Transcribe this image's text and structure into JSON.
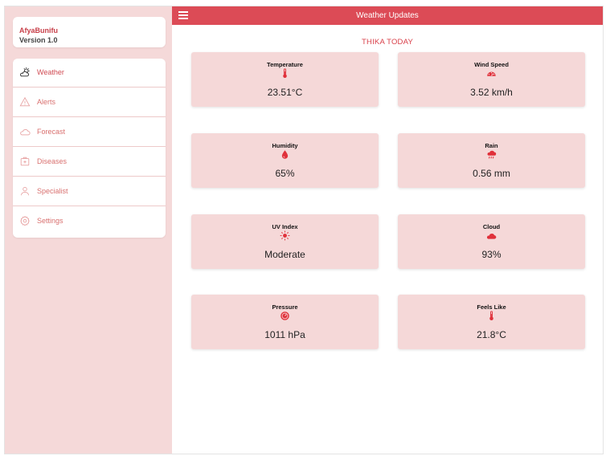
{
  "app": {
    "name": "AfyaBunifu",
    "version": "Version 1.0"
  },
  "header": {
    "title": "Weather Updates"
  },
  "sidebar": {
    "items": [
      {
        "label": "Weather",
        "icon": "cloud-sun-icon"
      },
      {
        "label": "Alerts",
        "icon": "warning-icon"
      },
      {
        "label": "Forecast",
        "icon": "cloud-icon"
      },
      {
        "label": "Diseases",
        "icon": "medical-kit-icon"
      },
      {
        "label": "Specialist",
        "icon": "person-icon"
      },
      {
        "label": "Settings",
        "icon": "gear-icon"
      }
    ]
  },
  "main": {
    "location": "THIKA TODAY",
    "cards": [
      {
        "title": "Temperature",
        "value": "23.51°C",
        "icon": "thermometer-icon"
      },
      {
        "title": "Wind Speed",
        "value": "3.52 km/h",
        "icon": "speedometer-icon"
      },
      {
        "title": "Humidity",
        "value": "65%",
        "icon": "water-drop-icon"
      },
      {
        "title": "Rain",
        "value": "0.56 mm",
        "icon": "rain-cloud-icon"
      },
      {
        "title": "UV Index",
        "value": "Moderate",
        "icon": "sun-icon"
      },
      {
        "title": "Cloud",
        "value": "93%",
        "icon": "cloud-icon"
      },
      {
        "title": "Pressure",
        "value": "1011 hPa",
        "icon": "gauge-icon"
      },
      {
        "title": "Feels Like",
        "value": "21.8°C",
        "icon": "thermometer-icon"
      }
    ]
  },
  "colors": {
    "accent": "#dc4b56",
    "sidebar_bg": "#f5d9d9",
    "card_bg": "#f5d8d8",
    "icon_red": "#e0303a"
  }
}
